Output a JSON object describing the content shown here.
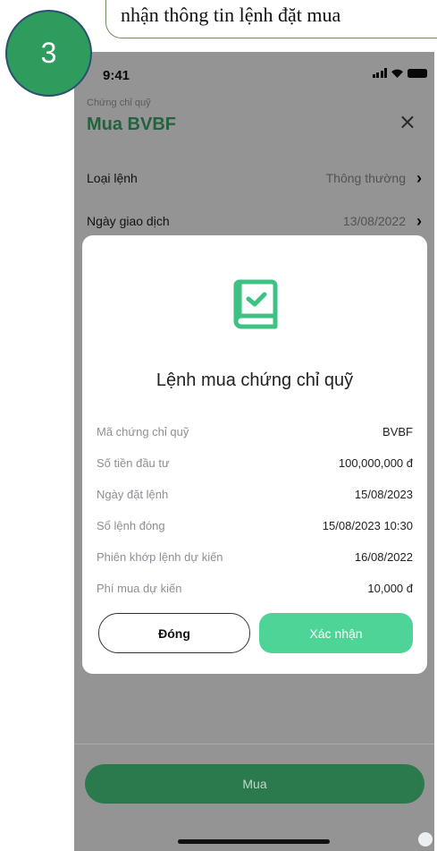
{
  "caption": {
    "text": "nhận thông tin lệnh đặt mua"
  },
  "step": {
    "number": "3"
  },
  "status_bar": {
    "time": "9:41"
  },
  "header": {
    "subtitle": "Chứng chỉ quỹ",
    "title": "Mua BVBF",
    "close_icon": "close-icon"
  },
  "form": {
    "rows": [
      {
        "label": "Loại lệnh",
        "value": "Thông thường"
      },
      {
        "label": "Ngày giao dịch",
        "value": "13/08/2022"
      }
    ]
  },
  "modal": {
    "icon": "document-check-icon",
    "title": "Lệnh mua chứng chỉ quỹ",
    "details": [
      {
        "label": "Mã chứng chỉ quỹ",
        "value": "BVBF"
      },
      {
        "label": "Số tiền đầu tư",
        "value": "100,000,000 đ"
      },
      {
        "label": "Ngày đặt lệnh",
        "value": "15/08/2023"
      },
      {
        "label": "Sổ lệnh đóng",
        "value": "15/08/2023 10:30"
      },
      {
        "label": "Phiên khớp lệnh dự kiến",
        "value": "16/08/2022"
      },
      {
        "label": "Phí mua dự kiến",
        "value": "10,000 đ"
      }
    ],
    "close_label": "Đóng",
    "confirm_label": "Xác nhận"
  },
  "footer": {
    "buy_label": "Mua"
  },
  "colors": {
    "accent": "#4fd497",
    "title_green": "#3ea86d",
    "step_circle": "#2e9c5d"
  }
}
